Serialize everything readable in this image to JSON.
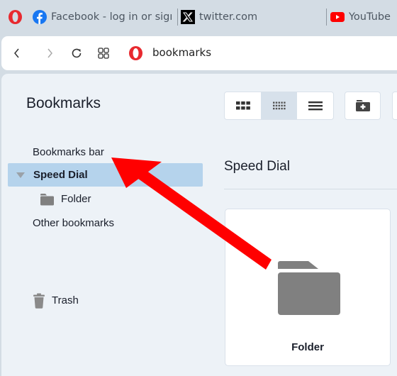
{
  "tabs": [
    {
      "title": "Facebook - log in or sign up",
      "icon": "facebook-icon"
    },
    {
      "title": "twitter.com",
      "icon": "x-twitter-icon"
    },
    {
      "title": "YouTube",
      "icon": "youtube-icon"
    }
  ],
  "address_bar": {
    "url": "bookmarks",
    "icon": "opera-logo-icon"
  },
  "bookmarks": {
    "title": "Bookmarks",
    "view_modes": [
      {
        "name": "large-grid",
        "active": false
      },
      {
        "name": "small-grid",
        "active": true
      },
      {
        "name": "list",
        "active": false
      }
    ],
    "new_folder_tooltip": "new-folder"
  },
  "sidebar": {
    "items": [
      {
        "label": "Bookmarks bar"
      },
      {
        "label": "Speed Dial",
        "selected": true,
        "expanded": true
      },
      {
        "label": "Folder"
      },
      {
        "label": "Other bookmarks"
      },
      {
        "label": "Trash"
      }
    ]
  },
  "main": {
    "section_title": "Speed Dial",
    "cards": [
      {
        "label": "Folder",
        "icon": "folder-icon"
      }
    ]
  },
  "colors": {
    "opera_red": "#e8292f",
    "selection": "#b5d3ec",
    "annotation_arrow": "#ff0000",
    "folder_gray": "#808080"
  }
}
